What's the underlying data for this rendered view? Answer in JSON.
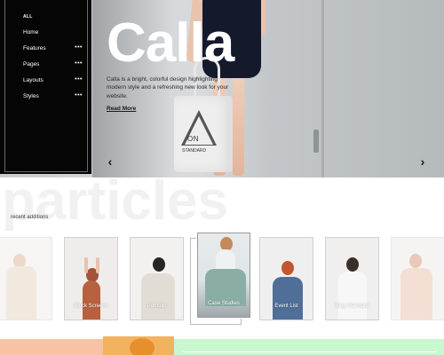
{
  "sidebar": {
    "all_label": "ALL",
    "items": [
      {
        "label": "Home",
        "has_more": false
      },
      {
        "label": "Features",
        "has_more": true
      },
      {
        "label": "Pages",
        "has_more": true
      },
      {
        "label": "Layouts",
        "has_more": true
      },
      {
        "label": "Styles",
        "has_more": true
      }
    ],
    "more_glyph": "•••"
  },
  "hero": {
    "title": "Calla",
    "description": "Calla is a bright, colorful design highlighting modern style and a refreshing new look for your website.",
    "link": "Read More",
    "prev_glyph": "‹",
    "next_glyph": "›",
    "bag_text_1": "ON",
    "bag_text_2": "STANDARD"
  },
  "particles": {
    "ghost_word": "particles",
    "section_label": "recent additions",
    "cards": [
      {
        "caption": ""
      },
      {
        "caption": "Block Screens"
      },
      {
        "caption": "Portfolio"
      },
      {
        "caption": "Case Studies"
      },
      {
        "caption": "Event List"
      },
      {
        "caption": "Blog Standard"
      },
      {
        "caption": ""
      }
    ]
  },
  "colors": {
    "sidebar_bg": "#050505",
    "band_left": "#f9c2a4",
    "band_middle": "#f2b25e",
    "band_right": "#c9f7cf"
  }
}
